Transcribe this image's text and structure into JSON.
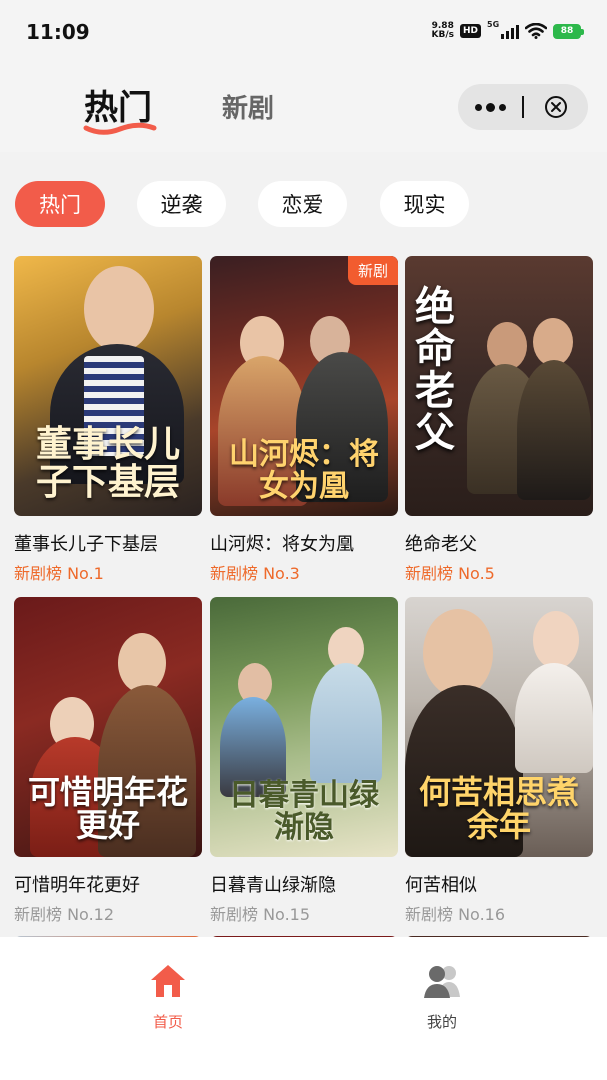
{
  "status_bar": {
    "time": "11:09",
    "net_speed_value": "9.88",
    "net_speed_unit": "KB/s",
    "hd_label": "HD",
    "network_label": "5G",
    "battery": "88"
  },
  "header": {
    "tabs": [
      {
        "label": "热门",
        "active": true
      },
      {
        "label": "新剧",
        "active": false
      }
    ],
    "more_icon": "more-dots-icon",
    "close_icon": "circle-close-icon"
  },
  "categories": [
    {
      "label": "热门",
      "active": true
    },
    {
      "label": "逆袭",
      "active": false
    },
    {
      "label": "恋爱",
      "active": false
    },
    {
      "label": "现实",
      "active": false
    }
  ],
  "dramas": [
    {
      "title": "董事长儿子下基层",
      "rank": "新剧榜 No.1",
      "poster_text": "董事长儿子下基层",
      "badge": "",
      "highlight": true
    },
    {
      "title": "山河烬：将女为凰",
      "rank": "新剧榜 No.3",
      "poster_text": "山河烬：将女为凰",
      "badge": "新剧",
      "highlight": true
    },
    {
      "title": "绝命老父",
      "rank": "新剧榜 No.5",
      "poster_text": "绝命老父",
      "badge": "",
      "highlight": true
    },
    {
      "title": "可惜明年花更好",
      "rank": "新剧榜 No.12",
      "poster_text": "可惜明年花更好",
      "badge": "",
      "highlight": false
    },
    {
      "title": "日暮青山绿渐隐",
      "rank": "新剧榜 No.15",
      "poster_text": "日暮青山绿渐隐",
      "badge": "",
      "highlight": false
    },
    {
      "title": "何苦相似",
      "rank": "新剧榜 No.16",
      "poster_text": "何苦相思煮余年",
      "badge": "",
      "highlight": false
    }
  ],
  "tabbar": [
    {
      "label": "首页",
      "icon": "home-icon",
      "active": true
    },
    {
      "label": "我的",
      "icon": "user-group-icon",
      "active": false
    }
  ],
  "colors": {
    "accent": "#f25c4a",
    "rank_highlight": "#ee6a2b",
    "rank_muted": "#999999"
  }
}
